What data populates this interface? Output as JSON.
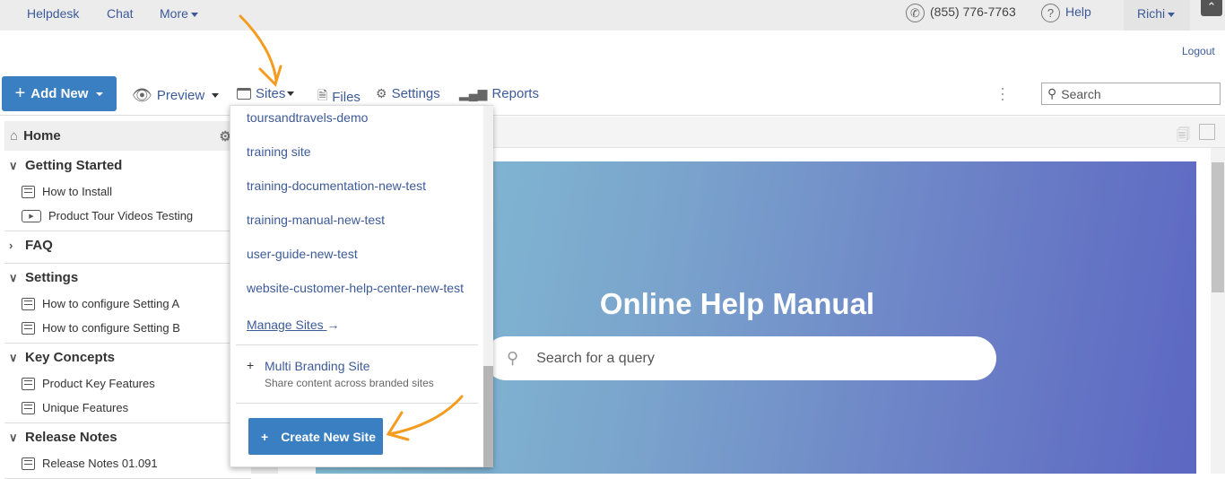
{
  "topbar": {
    "links": [
      "Helpdesk",
      "Chat",
      "More"
    ],
    "phone": "(855) 776-7763",
    "help": "Help",
    "user": "Richi",
    "logout": "Logout"
  },
  "toolbar": {
    "add_new": "Add New",
    "preview": "Preview",
    "sites": "Sites",
    "files": "Files",
    "settings": "Settings",
    "reports": "Reports",
    "search_placeholder": "Search"
  },
  "sidebar": {
    "home": "Home",
    "sections": [
      {
        "title": "Getting Started",
        "expanded": true,
        "items": [
          {
            "label": "How to Install",
            "icon": "document-icon"
          },
          {
            "label": "Product Tour Videos Testing",
            "icon": "video-icon"
          }
        ]
      },
      {
        "title": "FAQ",
        "expanded": false,
        "items": []
      },
      {
        "title": "Settings",
        "expanded": true,
        "items": [
          {
            "label": "How to configure Setting A",
            "icon": "document-icon"
          },
          {
            "label": "How to configure Setting B",
            "icon": "document-icon"
          }
        ]
      },
      {
        "title": "Key Concepts",
        "expanded": true,
        "items": [
          {
            "label": "Product Key Features",
            "icon": "document-icon"
          },
          {
            "label": "Unique Features",
            "icon": "document-icon"
          }
        ]
      },
      {
        "title": "Release Notes",
        "expanded": true,
        "items": [
          {
            "label": "Release Notes 01.091",
            "icon": "document-icon"
          }
        ]
      }
    ]
  },
  "sites_menu": {
    "sites": [
      "toursandtravels-demo",
      "training site",
      "training-documentation-new-test",
      "training-manual-new-test",
      "user-guide-new-test",
      "website-customer-help-center-new-test"
    ],
    "manage": "Manage Sites",
    "multi_title": "Multi Branding Site",
    "multi_desc": "Share content across branded sites",
    "create": "Create New Site"
  },
  "hero": {
    "title": "Online Help Manual",
    "search_placeholder": "Search for a query"
  },
  "colors": {
    "primary": "#3a7fc1",
    "link": "#3d5a98",
    "annotation_arrow": "#f39c1f",
    "hero_start": "#84c3d6",
    "hero_end": "#5c67c2"
  }
}
